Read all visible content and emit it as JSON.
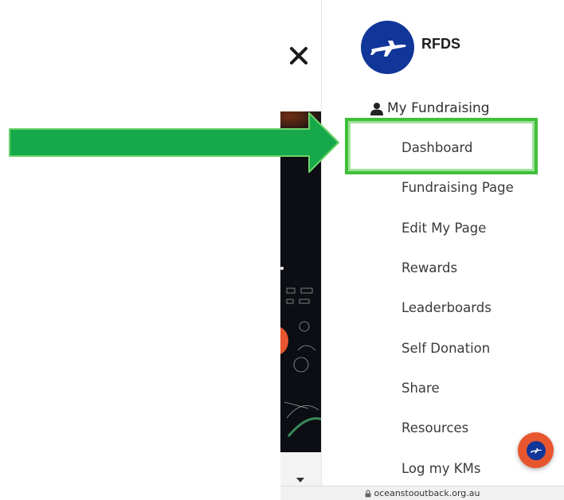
{
  "brand": {
    "name": "RFDS",
    "logo_icon": "plane-icon"
  },
  "nav": {
    "section_label": "My Fundraising",
    "section_icon": "user-icon",
    "items": [
      {
        "label": "Dashboard"
      },
      {
        "label": "Fundraising Page"
      },
      {
        "label": "Edit My Page"
      },
      {
        "label": "Rewards"
      },
      {
        "label": "Leaderboards"
      },
      {
        "label": "Self Donation"
      },
      {
        "label": "Share"
      },
      {
        "label": "Resources"
      },
      {
        "label": "Log my KMs"
      }
    ]
  },
  "controls": {
    "close_icon": "close-icon",
    "chat_icon": "plane-icon",
    "caret_icon": "caret-down-icon"
  },
  "browser": {
    "url": "oceanstooutback.org.au",
    "lock_icon": "lock-icon"
  },
  "colors": {
    "brand_blue": "#11369a",
    "accent_orange": "#e8562f",
    "highlight_green": "#3fbf3a",
    "arrow_green": "#17a84a"
  }
}
